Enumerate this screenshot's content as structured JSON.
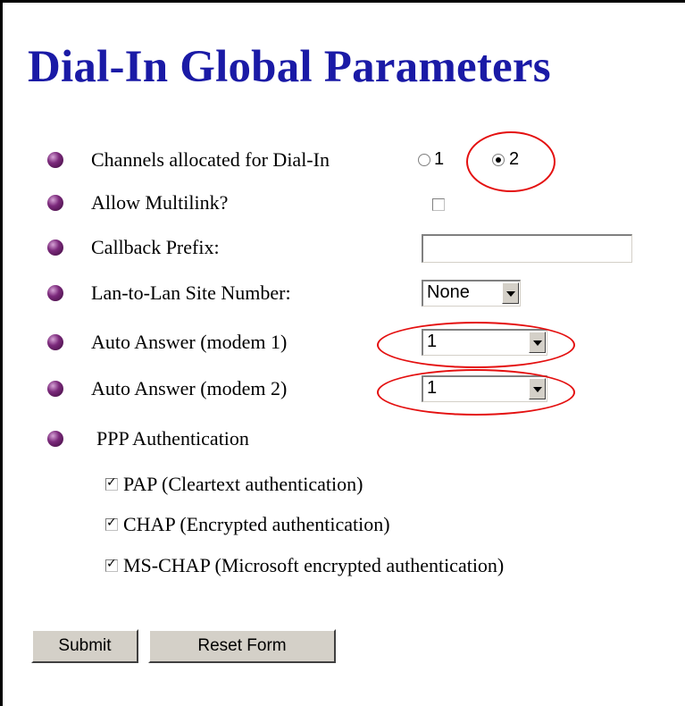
{
  "page": {
    "title": "Dial-In Global Parameters"
  },
  "channels": {
    "label": "Channels allocated for Dial-In",
    "options": [
      {
        "label": "1",
        "checked": false
      },
      {
        "label": "2",
        "checked": true
      }
    ]
  },
  "multilink": {
    "label": "Allow Multilink?",
    "checked": false
  },
  "callback_prefix": {
    "label": "Callback Prefix:",
    "value": ""
  },
  "lan_site": {
    "label": "Lan-to-Lan Site Number:",
    "selected": "None"
  },
  "auto_answer_1": {
    "label": "Auto Answer (modem 1)",
    "selected": "1"
  },
  "auto_answer_2": {
    "label": "Auto Answer (modem 2)",
    "selected": "1"
  },
  "ppp": {
    "label": "PPP Authentication",
    "options": [
      {
        "label": "PAP (Cleartext authentication)",
        "checked": true
      },
      {
        "label": "CHAP (Encrypted authentication)",
        "checked": true
      },
      {
        "label": "MS-CHAP (Microsoft encrypted authentication)",
        "checked": true
      }
    ]
  },
  "buttons": {
    "submit": "Submit",
    "reset": "Reset Form"
  },
  "colors": {
    "title": "#1a1aa6",
    "highlight": "#e41010",
    "button_face": "#d4d0c8"
  }
}
